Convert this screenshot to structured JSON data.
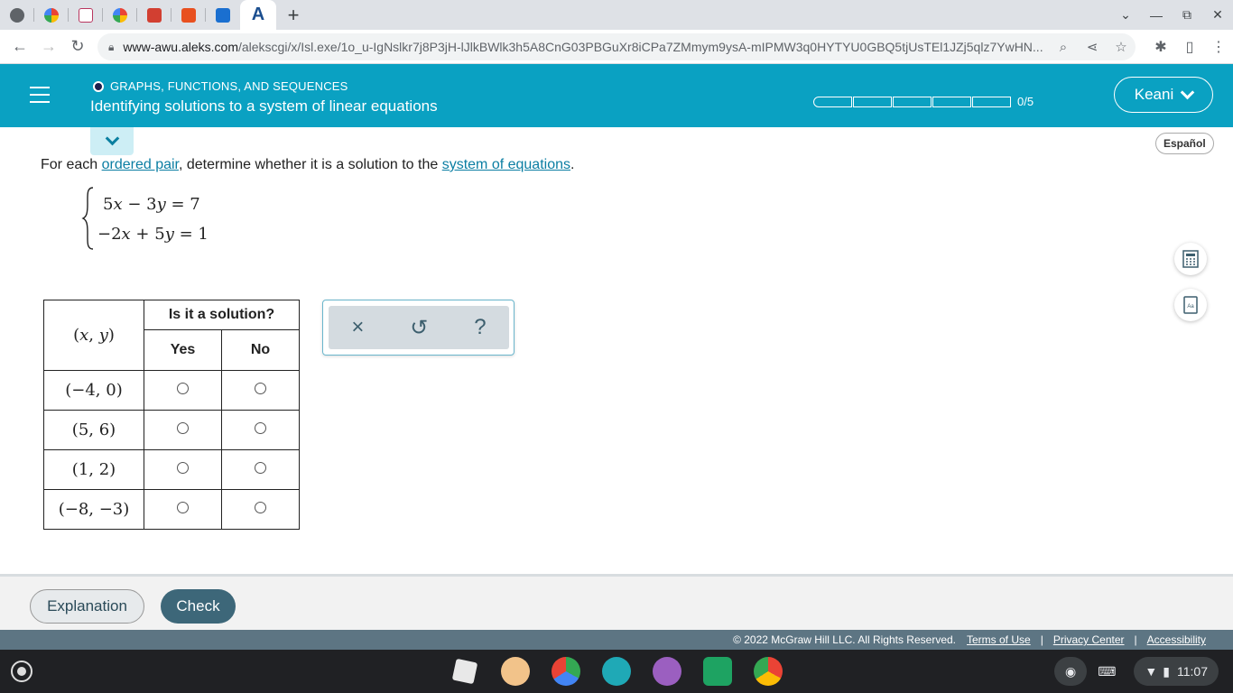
{
  "browser": {
    "url_host": "www-awu.aleks.com",
    "url_path": "/alekscgi/x/Isl.exe/1o_u-IgNslkr7j8P3jH-lJlkBWlk3h5A8CnG03PBGuXr8iCPa7ZMmym9ysA-mIPMW3q0HYTYU0GBQ5tjUsTEl1JZj5qlz7YwHN...",
    "active_tab_letter": "A",
    "new_tab": "+"
  },
  "header": {
    "topic": "GRAPHS, FUNCTIONS, AND SEQUENCES",
    "title": "Identifying solutions to a system of linear equations",
    "progress_text": "0/5",
    "progress_completed": 0,
    "progress_total": 5,
    "user": "Keani",
    "espanol": "Español"
  },
  "question": {
    "prompt_start": "For each ",
    "link1": "ordered pair",
    "prompt_mid": ", determine whether it is a solution to the ",
    "link2": "system of equations",
    "prompt_end": ".",
    "eq1": {
      "a": "5",
      "v1": "x",
      "op": " − 3",
      "v2": "y",
      "rhs": " = 7"
    },
    "eq2": {
      "a": "−2",
      "v1": "x",
      "op": " + 5",
      "v2": "y",
      "rhs": " = 1"
    }
  },
  "table": {
    "pair_header": "(x, y)",
    "pair_header_open": "(",
    "pair_header_x": "x",
    "pair_header_comma": ", ",
    "pair_header_y": "y",
    "pair_header_close": ")",
    "group_header": "Is it a solution?",
    "yes": "Yes",
    "no": "No",
    "rows": [
      "(−4, 0)",
      "(5, 6)",
      "(1, 2)",
      "(−8, −3)"
    ]
  },
  "tools": {
    "clear": "×",
    "undo": "↺",
    "help": "?"
  },
  "footer": {
    "explanation": "Explanation",
    "check": "Check",
    "copyright": "© 2022 McGraw Hill LLC. All Rights Reserved.",
    "terms": "Terms of Use",
    "privacy": "Privacy Center",
    "accessibility": "Accessibility",
    "sep": "|"
  },
  "shelf": {
    "time": "11:07"
  },
  "colors": {
    "header": "#0aa1c2",
    "check_button": "#3d6779",
    "link": "#0b7ea3"
  }
}
